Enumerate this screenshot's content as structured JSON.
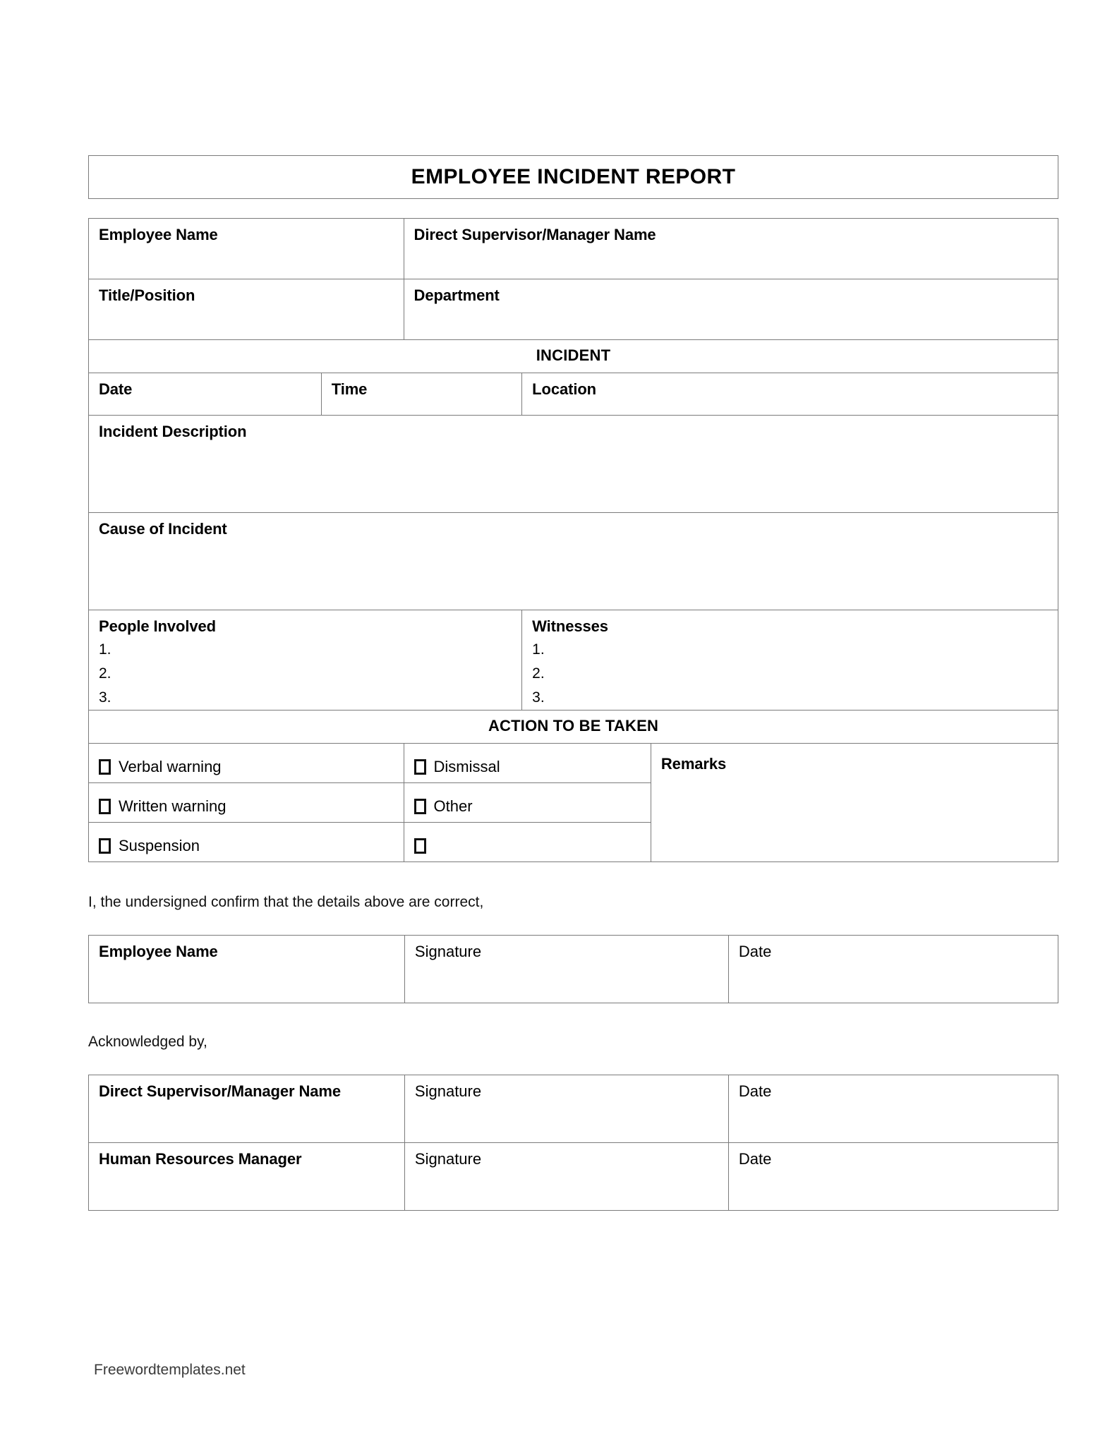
{
  "document": {
    "title": "EMPLOYEE INCIDENT REPORT",
    "footer_watermark": "Freewordtemplates.net",
    "band_color": "#dce6f2",
    "border_color": "#7b7b7b"
  },
  "employee_info": {
    "employee_name_label": "Employee Name",
    "supervisor_label": "Direct Supervisor/Manager Name",
    "title_position_label": "Title/Position",
    "department_label": "Department"
  },
  "incident": {
    "section_header": "INCIDENT",
    "date_label": "Date",
    "time_label": "Time",
    "location_label": "Location",
    "description_label": "Incident Description",
    "cause_label": "Cause of Incident",
    "people_involved_label": "People Involved",
    "witnesses_label": "Witnesses",
    "people_numbers": [
      "1.",
      "2.",
      "3."
    ],
    "witness_numbers": [
      "1.",
      "2.",
      "3."
    ]
  },
  "action": {
    "section_header": "ACTION TO BE TAKEN",
    "remarks_label": "Remarks",
    "left_options": [
      "Verbal warning",
      "Written warning",
      "Suspension"
    ],
    "right_options": [
      "Dismissal",
      "Other",
      ""
    ]
  },
  "confirmation": {
    "statement": "I, the undersigned confirm that the details above are correct,",
    "columns": [
      "Employee Name",
      "Signature",
      "Date"
    ]
  },
  "acknowledgement": {
    "statement": "Acknowledged by,",
    "rows": [
      {
        "name": "Direct Supervisor/Manager Name",
        "signature": "Signature",
        "date": "Date"
      },
      {
        "name": "Human Resources Manager",
        "signature": "Signature",
        "date": "Date"
      }
    ]
  }
}
